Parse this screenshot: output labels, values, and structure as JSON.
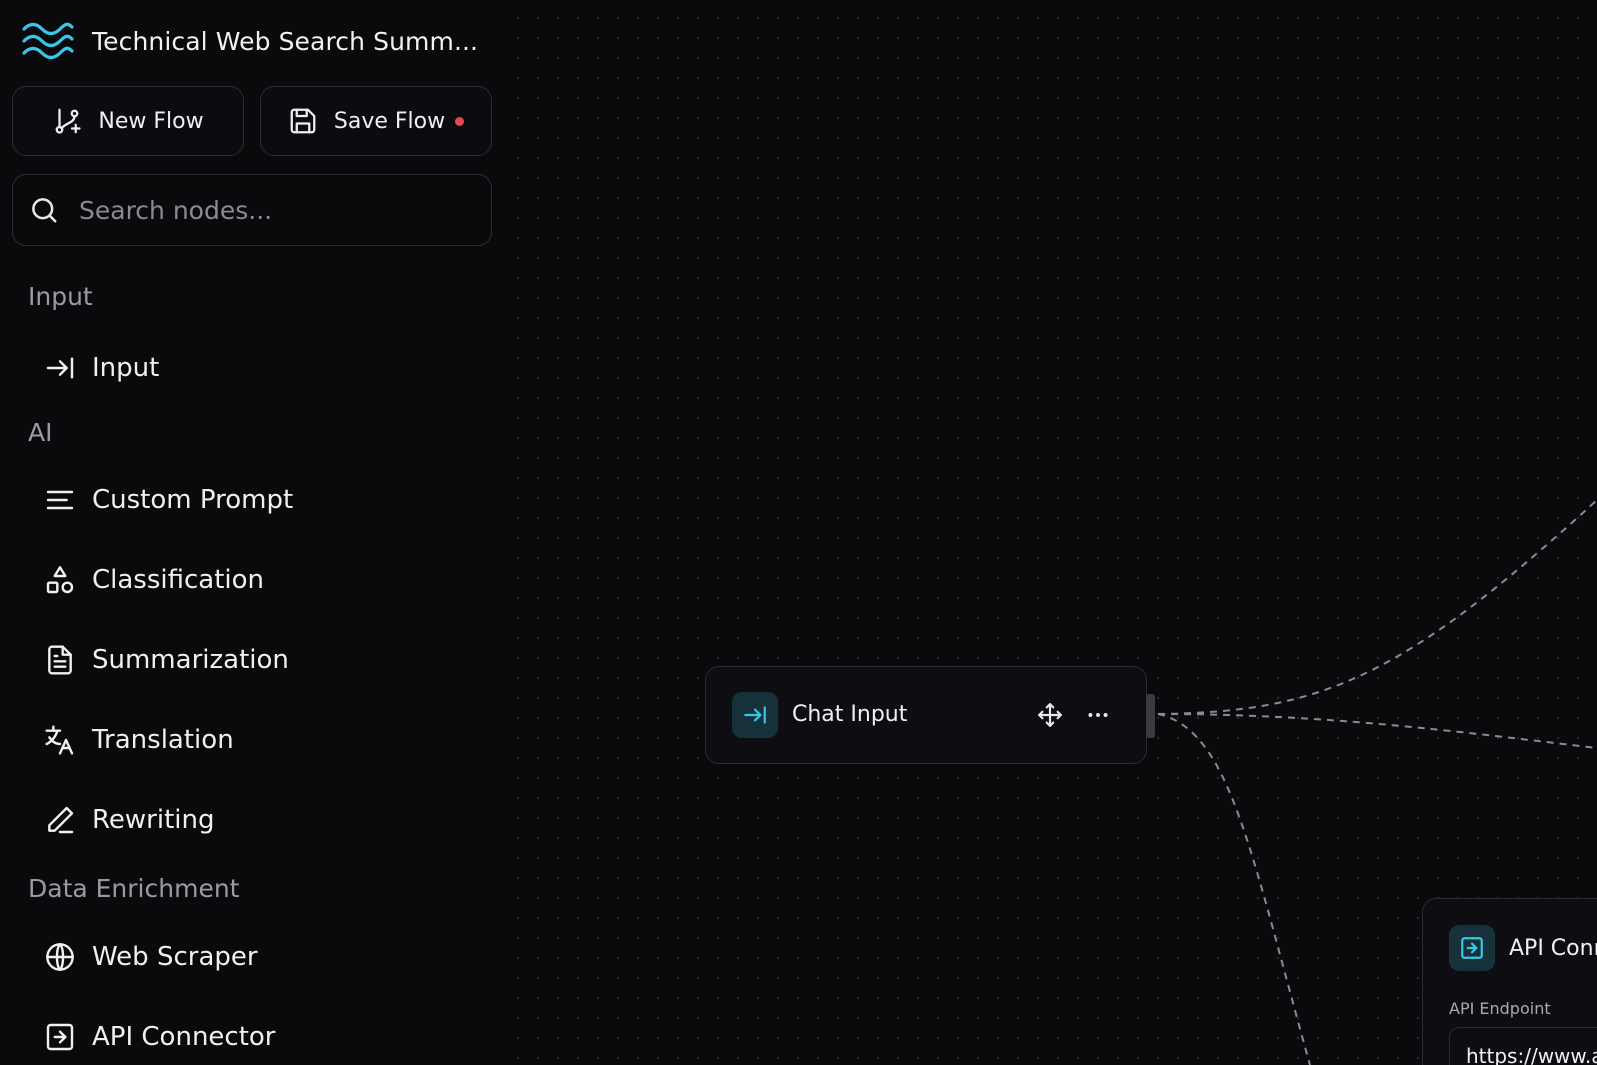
{
  "app": {
    "title": "Technical Web Search Summ..."
  },
  "toolbar": {
    "new_flow_label": "New Flow",
    "save_flow_label": "Save Flow",
    "unsaved_indicator_color": "#e5484d"
  },
  "search": {
    "placeholder": "Search nodes...",
    "value": ""
  },
  "sidebar": {
    "sections": [
      {
        "label": "Input",
        "items": [
          {
            "label": "Input",
            "icon": "arrow-right-to-line-icon"
          }
        ]
      },
      {
        "label": "AI",
        "items": [
          {
            "label": "Custom Prompt",
            "icon": "text-lines-icon"
          },
          {
            "label": "Classification",
            "icon": "shapes-icon"
          },
          {
            "label": "Summarization",
            "icon": "document-icon"
          },
          {
            "label": "Translation",
            "icon": "translate-icon"
          },
          {
            "label": "Rewriting",
            "icon": "pencil-icon"
          }
        ]
      },
      {
        "label": "Data Enrichment",
        "items": [
          {
            "label": "Web Scraper",
            "icon": "globe-icon"
          },
          {
            "label": "API Connector",
            "icon": "box-arrow-right-icon"
          }
        ]
      }
    ]
  },
  "canvas": {
    "nodes": [
      {
        "id": "chat-input",
        "title": "Chat Input",
        "icon": "arrow-right-to-line-icon"
      },
      {
        "id": "api-connector",
        "title": "API Connector",
        "icon": "box-arrow-right-icon",
        "fields": [
          {
            "label": "API Endpoint",
            "value": "https://www.al"
          }
        ]
      }
    ]
  },
  "colors": {
    "background": "#0a0a0d",
    "accent": "#38c7e6",
    "node_icon_bg": "#163139",
    "border": "#2b2b31"
  }
}
